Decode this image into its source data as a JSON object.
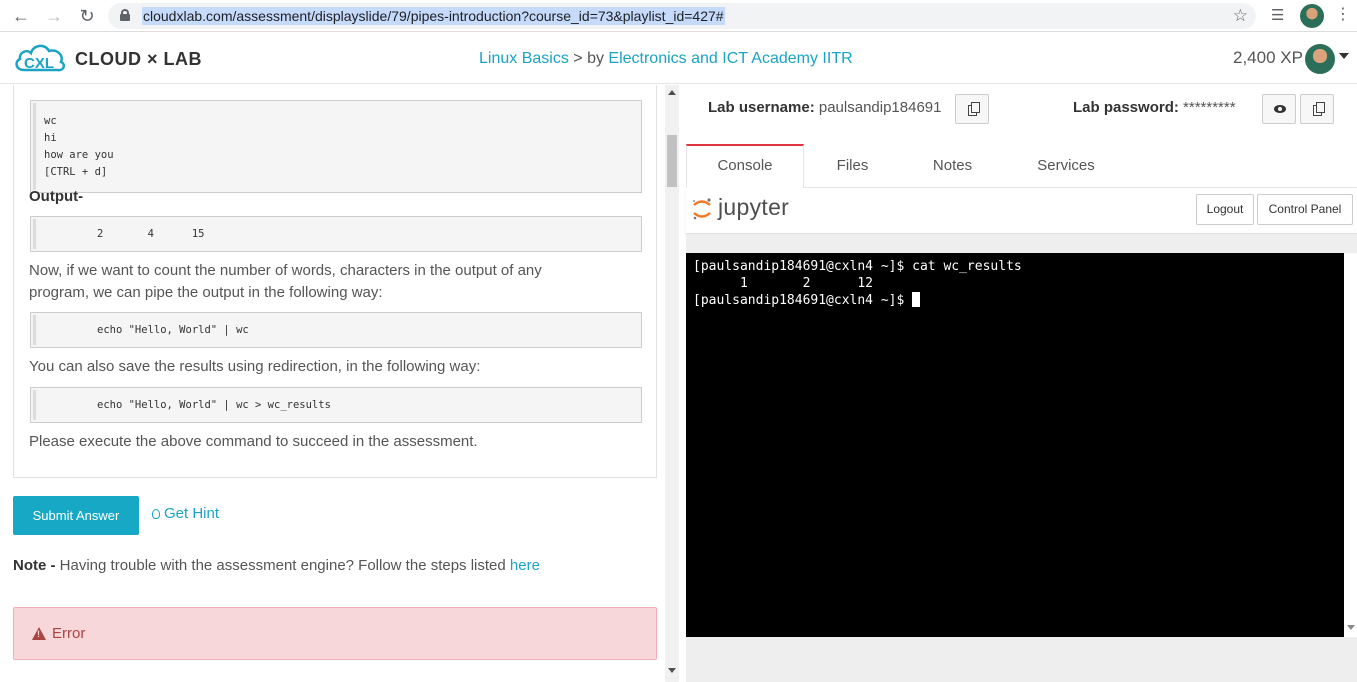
{
  "browser": {
    "url": "cloudxlab.com/assessment/displayslide/79/pipes-introduction?course_id=73&playlist_id=427#"
  },
  "header": {
    "logo_text": "CLOUD × LAB",
    "breadcrumb_course": "Linux Basics",
    "breadcrumb_sep": " > by ",
    "breadcrumb_author": "Electronics and ICT Academy IITR",
    "xp": "2,400 XP"
  },
  "lesson": {
    "input_lines": [
      "wc",
      "hi",
      "how are you",
      "[CTRL + d]"
    ],
    "output_label": "Output-",
    "output_value": "2       4      15",
    "para_pipe": "Now, if we want to count the number of words, characters in the output of any program, we can pipe the output in the following way:",
    "code_pipe": "echo \"Hello, World\" | wc",
    "para_redirect": "You can also save the results using redirection, in the following way:",
    "code_redirect": "echo \"Hello, World\" | wc > wc_results",
    "para_execute": "Please execute the above command to succeed in the assessment."
  },
  "actions": {
    "submit_label": "Submit Answer",
    "hint_label": "Get Hint"
  },
  "note": {
    "label": "Note -",
    "text": " Having trouble with the assessment engine? Follow the steps listed ",
    "link": "here"
  },
  "error": {
    "text": "Error",
    "color": "#a94442",
    "bg": "#f8d7da"
  },
  "lab": {
    "username_label": "Lab username:",
    "username": "paulsandip184691",
    "password_label": "Lab password:",
    "password": "*********"
  },
  "tabs": [
    {
      "label": "Console",
      "active": true
    },
    {
      "label": "Files",
      "active": false
    },
    {
      "label": "Notes",
      "active": false
    },
    {
      "label": "Services",
      "active": false
    }
  ],
  "jupyter": {
    "brand": "jupyter",
    "logout_label": "Logout",
    "control_panel_label": "Control Panel"
  },
  "terminal": {
    "lines": [
      "[paulsandip184691@cxln4 ~]$ cat wc_results",
      "      1       2      12",
      "[paulsandip184691@cxln4 ~]$ "
    ]
  },
  "colors": {
    "accent": "#17a8c6",
    "link": "#1aa3c4",
    "active_tab": "#e0353b"
  }
}
